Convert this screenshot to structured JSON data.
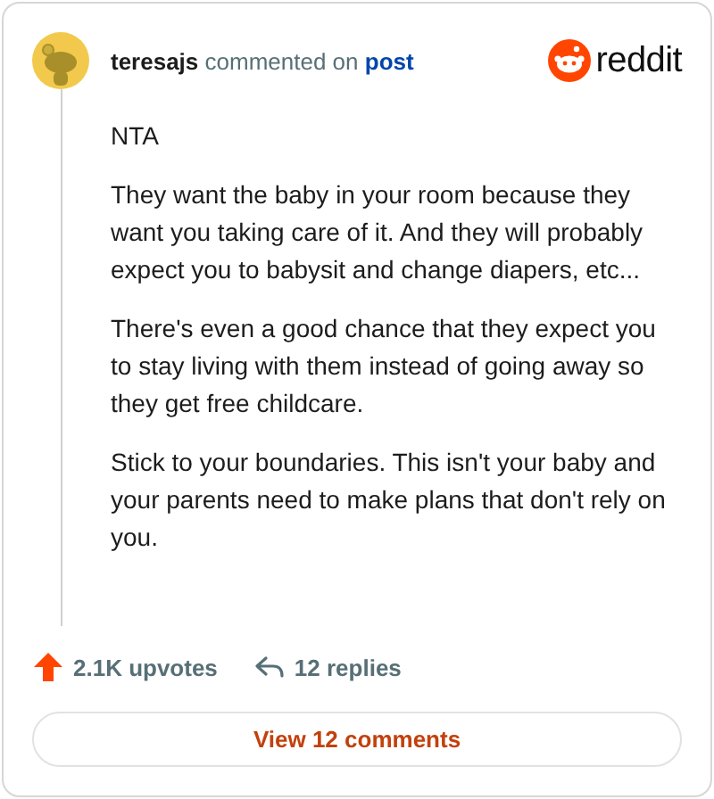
{
  "comment": {
    "author": "teresajs",
    "action": "commented on",
    "post_link": "post",
    "paragraphs": [
      "NTA",
      "They want the baby in your room because they want you taking care of it. And they will probably expect you to babysit and change diapers, etc...",
      "There's even a good chance that they expect you to stay living with them instead of going away so they get free childcare.",
      "Stick to your boundaries. This isn't your baby and your parents need to make plans that don't rely on you."
    ]
  },
  "brand": {
    "logo_text": "reddit"
  },
  "stats": {
    "upvotes": "2.1K upvotes",
    "replies": "12 replies"
  },
  "view_button": "View 12 comments"
}
